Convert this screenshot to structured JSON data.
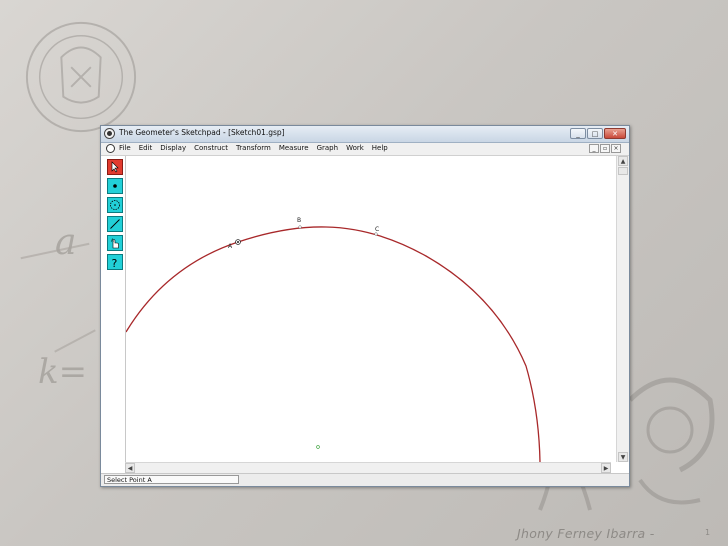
{
  "window": {
    "title": "The Geometer's Sketchpad - [Sketch01.gsp]",
    "controls": [
      "_",
      "□",
      "✕"
    ]
  },
  "menubar": {
    "items": [
      "File",
      "Edit",
      "Display",
      "Construct",
      "Transform",
      "Measure",
      "Graph",
      "Work",
      "Help"
    ],
    "doc_controls": [
      "_",
      "▫",
      "×"
    ]
  },
  "toolbox": {
    "tools": [
      {
        "name": "selection-arrow-tool",
        "icon": "arrow-icon"
      },
      {
        "name": "point-tool",
        "icon": "point-icon"
      },
      {
        "name": "compass-tool",
        "icon": "circle-icon"
      },
      {
        "name": "straightedge-tool",
        "icon": "line-icon"
      },
      {
        "name": "text-tool",
        "icon": "hand-icon"
      },
      {
        "name": "custom-tool",
        "icon": "question-icon"
      }
    ]
  },
  "sketch": {
    "point_labels": [
      "A",
      "B",
      "C"
    ],
    "curve_color": "#a8282a"
  },
  "statusbar": {
    "text": "Select Point A"
  },
  "slide": {
    "footer": "Jhony Ferney Ibarra -",
    "page_number": "1"
  }
}
